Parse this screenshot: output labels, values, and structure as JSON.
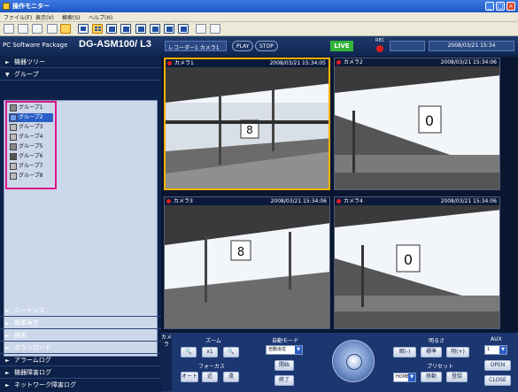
{
  "window": {
    "title": "操作モニター"
  },
  "menu": [
    "ファイル(F)",
    "表示(V)",
    "検索(S)",
    "ヘルプ(H)"
  ],
  "header": {
    "package_label": "PC Software Package",
    "model": "DG-ASM100/ L3",
    "recorder_camera": "レコーダー1 カメラ1",
    "btn_play": "PLAY",
    "btn_stop": "STOP",
    "live": "LIVE",
    "rec": "REC",
    "datetime": "2008/03/21 15:34"
  },
  "sidebar": {
    "device_tree": "機器ツリー",
    "group": "グループ",
    "groups": [
      "グループ1",
      "グループ2",
      "グループ3",
      "グループ4",
      "グループ5",
      "グループ6",
      "グループ7",
      "グループ8"
    ],
    "selected_group_index": 1,
    "bottom": [
      "シーケンス",
      "簡単再生",
      "検索",
      "ダウンロード",
      "アラームログ",
      "機器障害ログ",
      "ネットワーク障害ログ"
    ]
  },
  "cameras": [
    {
      "name": "カメラ1",
      "timestamp": "2008/03/21 15:34:05",
      "selected": true
    },
    {
      "name": "カメラ2",
      "timestamp": "2008/03/21 15:34:06",
      "selected": false
    },
    {
      "name": "カメラ3",
      "timestamp": "2008/03/21 15:34:06",
      "selected": false
    },
    {
      "name": "カメラ4",
      "timestamp": "2008/03/21 15:34:06",
      "selected": false
    }
  ],
  "controls": {
    "tab": "カメラ",
    "zoom_label": "ズーム",
    "zoom_x1": "x1",
    "focus_label": "フォーカス",
    "focus_auto": "オート",
    "focus_near": "近",
    "focus_far": "遠",
    "auto_mode_label": "自動モード",
    "auto_mode_value": "自動追従",
    "start": "開始",
    "end": "終了",
    "brightness_label": "明るさ",
    "dark": "暗(-)",
    "standard": "標準",
    "bright": "明(+)",
    "preset_label": "プリセット",
    "preset_value": "HOME",
    "move": "移動",
    "register": "登録",
    "aux_label": "AUX",
    "aux_value": "1",
    "open": "OPEN",
    "close": "CLOSE"
  }
}
